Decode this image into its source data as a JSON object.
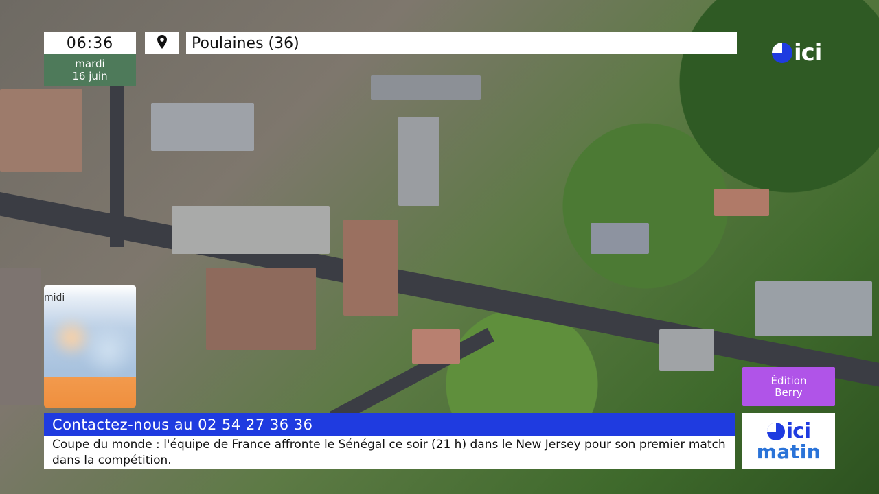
{
  "clock": {
    "time": "06:36",
    "day": "mardi",
    "date": "16 juin"
  },
  "location": {
    "pin_icon": "map-pin-icon",
    "name": "Poulaines (36)"
  },
  "brand": {
    "logo_text": "ici",
    "color": "#1f3be0"
  },
  "weather": {
    "period_label": "midi"
  },
  "edition": {
    "line1": "Édition",
    "line2": "Berry",
    "color": "#b054e8"
  },
  "ticker": {
    "headline": "Contactez-nous au 02 54 27 36 36",
    "body": "Coupe du monde : l'équipe de France affronte le Sénégal ce soir (21 h) dans le New Jersey pour son premier match dans la compétition.",
    "accent": "#1f3be0"
  },
  "show": {
    "logo_text": "ici",
    "name": "matin"
  }
}
